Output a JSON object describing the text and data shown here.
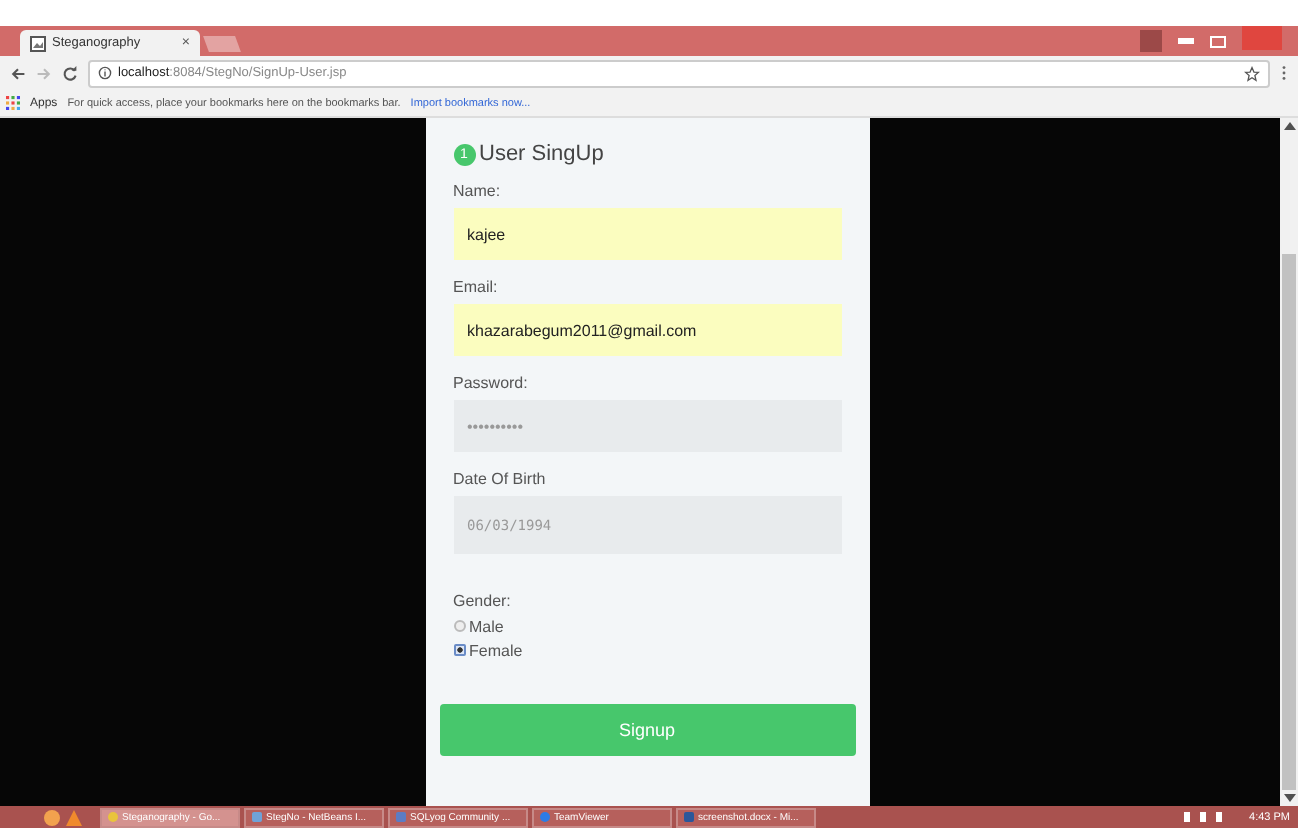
{
  "browser": {
    "tab_title": "Steganography",
    "tab_close": "×",
    "url_host": "localhost",
    "url_path": ":8084/StegNo/SignUp-User.jsp",
    "bookmarks_apps": "Apps",
    "bookmarks_hint": "For quick access, place your bookmarks here on the bookmarks bar.",
    "bookmarks_link": "Import bookmarks now..."
  },
  "form": {
    "step": "1",
    "title": "User SingUp",
    "fields": [
      {
        "kind": "text",
        "label": "Name:",
        "value": "kajee"
      },
      {
        "kind": "text",
        "label": "Email:",
        "value": "khazarabegum2011@gmail.com"
      },
      {
        "kind": "password",
        "label": "Password:",
        "value": "••••••••••"
      },
      {
        "kind": "date",
        "label": "Date Of Birth",
        "value": "06/03/1994"
      }
    ],
    "gender": {
      "label": "Gender:",
      "options": [
        {
          "label": "Male",
          "selected": false
        },
        {
          "label": "Female",
          "selected": true
        }
      ]
    },
    "submit": "Signup"
  },
  "taskbar": {
    "items": [
      {
        "label": "Steganography - Go...",
        "selected": true
      },
      {
        "label": "StegNo - NetBeans I...",
        "selected": false
      },
      {
        "label": "SQLyog Community ...",
        "selected": false
      },
      {
        "label": "TeamViewer",
        "selected": false
      },
      {
        "label": "screenshot.docx - Mi...",
        "selected": false
      }
    ],
    "clock": "4:43 PM"
  }
}
